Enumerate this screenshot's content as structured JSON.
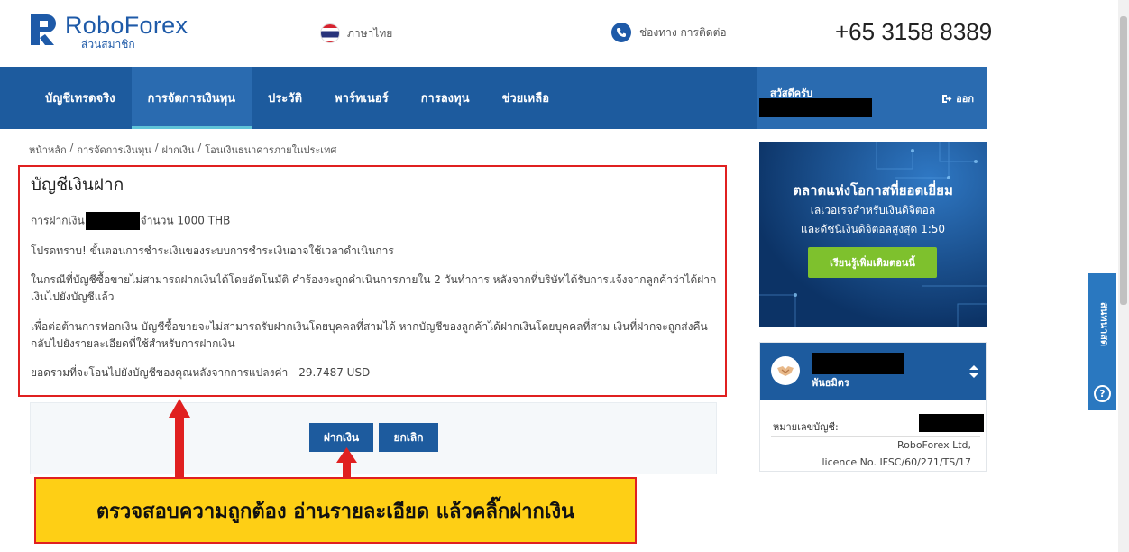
{
  "header": {
    "logo_name": "RoboForex",
    "logo_sub": "ส่วนสมาชิก",
    "language": "ภาษาไทย",
    "contact": "ช่องทาง การติดต่อ",
    "phone": "+65 3158 8389"
  },
  "nav": {
    "items": [
      "บัญชีเทรดจริง",
      "การจัดการเงินทุน",
      "ประวัติ",
      "พาร์ทเนอร์",
      "การลงทุน",
      "ช่วยเหลือ"
    ],
    "active_index": 1,
    "greeting": "สวัสดีครับ",
    "logout": "ออก"
  },
  "breadcrumb": [
    "หน้าหลัก",
    "/",
    "การจัดการเงินทุน",
    "/",
    "ฝากเงิน",
    "/",
    "โอนเงินธนาคารภายในประเทศ"
  ],
  "main": {
    "title": "บัญชีเงินฝาก",
    "deposit_prefix": "การฝากเงิน",
    "deposit_suffix": "จำนวน 1000 THB",
    "notice": "โปรดทราบ! ขั้นตอนการชำระเงินของระบบการชำระเงินอาจใช้เวลาดำเนินการ",
    "paragraph_auto": "ในกรณีที่บัญชีซื้อขายไม่สามารถฝากเงินได้โดยอัตโนมัติ คำร้องจะถูกดำเนินการภายใน 2 วันทำการ หลังจากที่บริษัทได้รับการแจ้งจากลูกค้าว่าได้ฝากเงินไปยังบัญชีแล้ว",
    "paragraph_aml": "เพื่อต่อต้านการฟอกเงิน บัญชีซื้อขายจะไม่สามารถรับฝากเงินโดยบุคคลที่สามได้ หากบัญชีของลูกค้าได้ฝากเงินโดยบุคคลที่สาม เงินที่ฝากจะถูกส่งคืนกลับไปยังรายละเอียดที่ใช้สำหรับการฝากเงิน",
    "total": "ยอดรวมที่จะโอนไปยังบัญชีของคุณหลังจากการแปลงค่า - 29.7487 USD",
    "deposit_button": "ฝากเงิน",
    "cancel_button": "ยกเลิก"
  },
  "annotation": {
    "callout": "ตรวจสอบความถูกต้อง อ่านรายละเอียด แล้วคลิ๊กฝากเงิน",
    "color": "#e02020"
  },
  "sidebar": {
    "promo_title": "ตลาดแห่งโอกาสที่ยอดเยี่ยม",
    "promo_line1": "เลเวอเรจสำหรับเงินดิจิตอล",
    "promo_line2": "และดัชนีเงินดิจิตอลสูงสุด 1:50",
    "promo_button": "เรียนรู้เพิ่มเติมตอนนี้",
    "account_type": "พันธมิตร",
    "account_number_label": "หมายเลขบัญชี:",
    "company": "RoboForex Ltd,",
    "licence": "licence No. IFSC/60/271/TS/17",
    "side_tab": "สนทนาสด"
  },
  "colors": {
    "brand_blue": "#1d5b9e",
    "promo_bg": "#0f3e74",
    "promo_button": "#7ec12d",
    "callout_bg": "#fecf15"
  }
}
